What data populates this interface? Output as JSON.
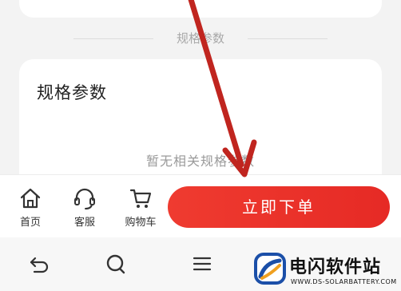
{
  "section": {
    "divider_label": "规格参数"
  },
  "spec_card": {
    "title": "规格参数",
    "empty_text": "暂无相关规格参数"
  },
  "action_bar": {
    "home_label": "首页",
    "home_icon": "home-icon",
    "service_label": "客服",
    "service_icon": "headset-icon",
    "cart_label": "购物车",
    "cart_icon": "cart-icon",
    "buy_label": "立即下单"
  },
  "system_nav": {
    "back_icon": "back-icon",
    "search_icon": "search-icon",
    "menu_icon": "menu-icon"
  },
  "watermark": {
    "title": "电闪软件站",
    "subtitle": "WWW.DS-SOLARBATTERY.COM"
  },
  "colors": {
    "accent": "#e62a25",
    "annotation_arrow": "#c0251f",
    "page_bg": "#f3f3f3",
    "card_bg": "#ffffff",
    "muted_text": "#9a9a9a"
  }
}
